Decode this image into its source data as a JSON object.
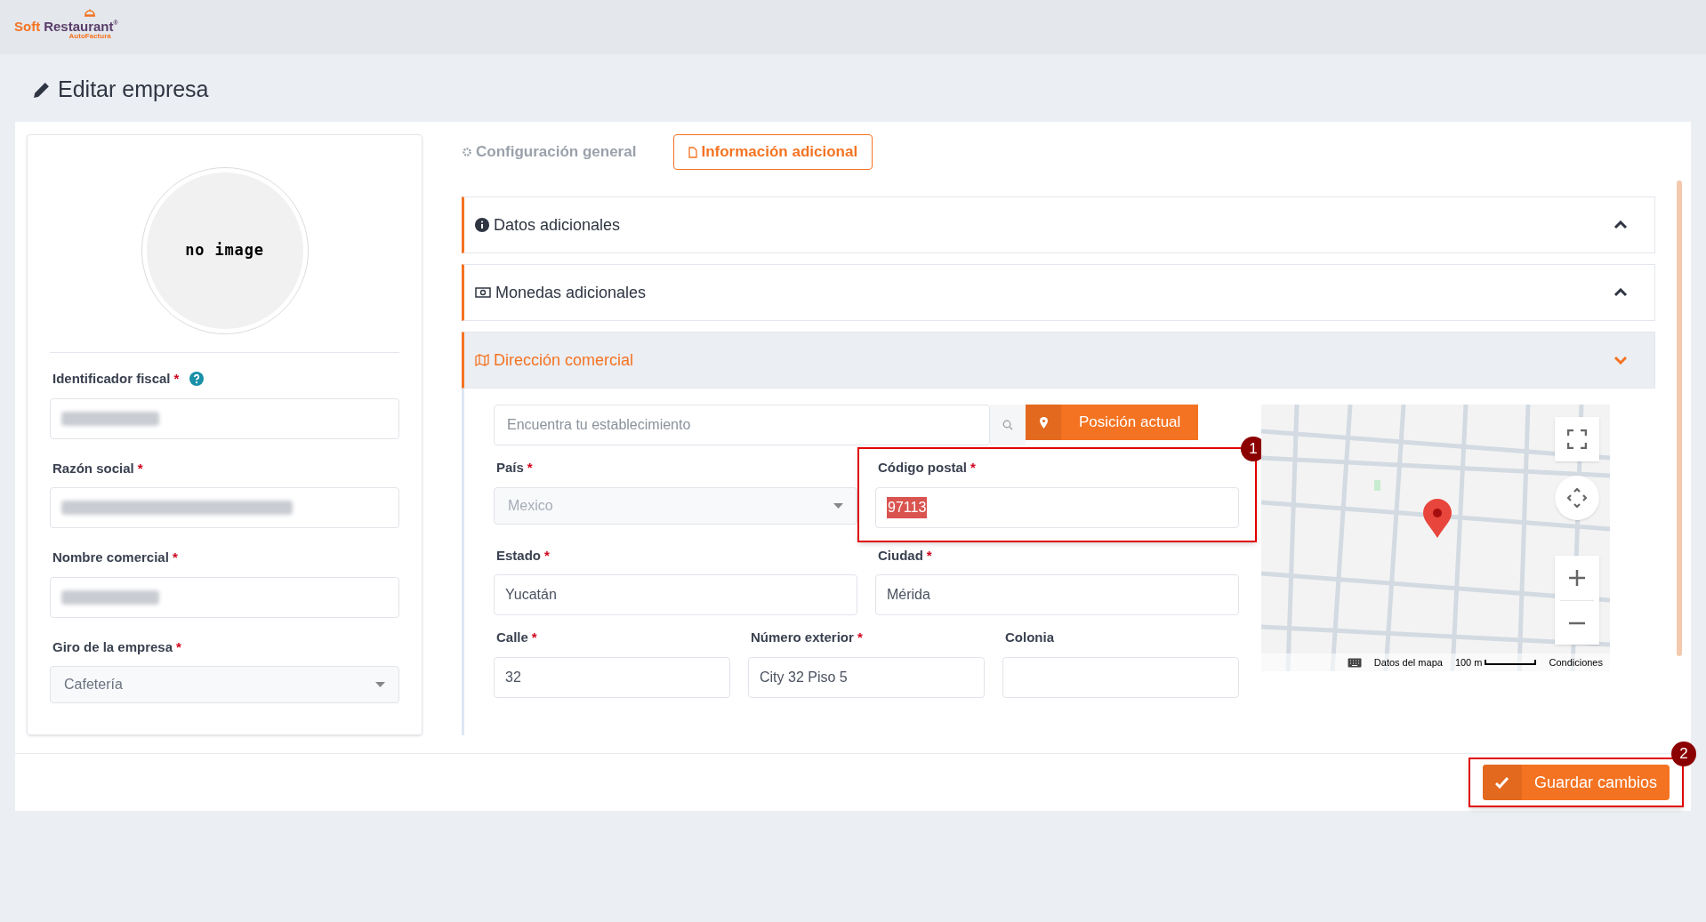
{
  "logo": {
    "brand_first": "Soft",
    "brand_second": "Restaurant",
    "registered": "®",
    "subtitle": "AutoFactura"
  },
  "page_title": "Editar empresa",
  "profile": {
    "image_text": "no image",
    "fields": [
      {
        "label": "Identificador fiscal",
        "required_mark": "*",
        "help": true,
        "kind": "text",
        "redacted": true
      },
      {
        "label": "Razón social",
        "required_mark": "*",
        "kind": "text",
        "redacted": true
      },
      {
        "label": "Nombre comercial",
        "required_mark": "*",
        "kind": "text",
        "redacted": true
      },
      {
        "label": "Giro de la empresa",
        "required_mark": "*",
        "kind": "select",
        "value": "Cafetería"
      }
    ]
  },
  "tabs": [
    {
      "label": "Configuración general",
      "selected": false
    },
    {
      "label": "Información adicional",
      "selected": true
    }
  ],
  "sections": [
    {
      "title": "Datos adicionales",
      "expanded": false
    },
    {
      "title": "Monedas adicionales",
      "expanded": false
    },
    {
      "title": "Dirección comercial",
      "expanded": true
    }
  ],
  "address": {
    "search": {
      "placeholder": "Encuentra tu establecimiento"
    },
    "locate_button": "Posición actual",
    "fields": [
      {
        "label": "País",
        "required_mark": "*",
        "kind": "select",
        "value": "Mexico",
        "disabled": true
      },
      {
        "label": "Código postal",
        "required_mark": "*",
        "kind": "text",
        "value": "97113",
        "text_selected": true
      },
      {
        "label": "Estado",
        "required_mark": "*",
        "kind": "text",
        "value": "Yucatán"
      },
      {
        "label": "Ciudad",
        "required_mark": "*",
        "kind": "text",
        "value": "Mérida"
      },
      {
        "label": "Calle",
        "required_mark": "*",
        "kind": "text",
        "value": "32"
      },
      {
        "label": "Número exterior",
        "required_mark": "*",
        "kind": "text",
        "value": "City 32 Piso 5"
      },
      {
        "label": "Colonia",
        "kind": "text"
      }
    ],
    "map": {
      "attribution": "Datos del mapa",
      "scale": "100 m",
      "terms": "Condiciones"
    }
  },
  "save_button": "Guardar cambios",
  "annotations": [
    {
      "label": "1"
    },
    {
      "label": "2"
    }
  ]
}
